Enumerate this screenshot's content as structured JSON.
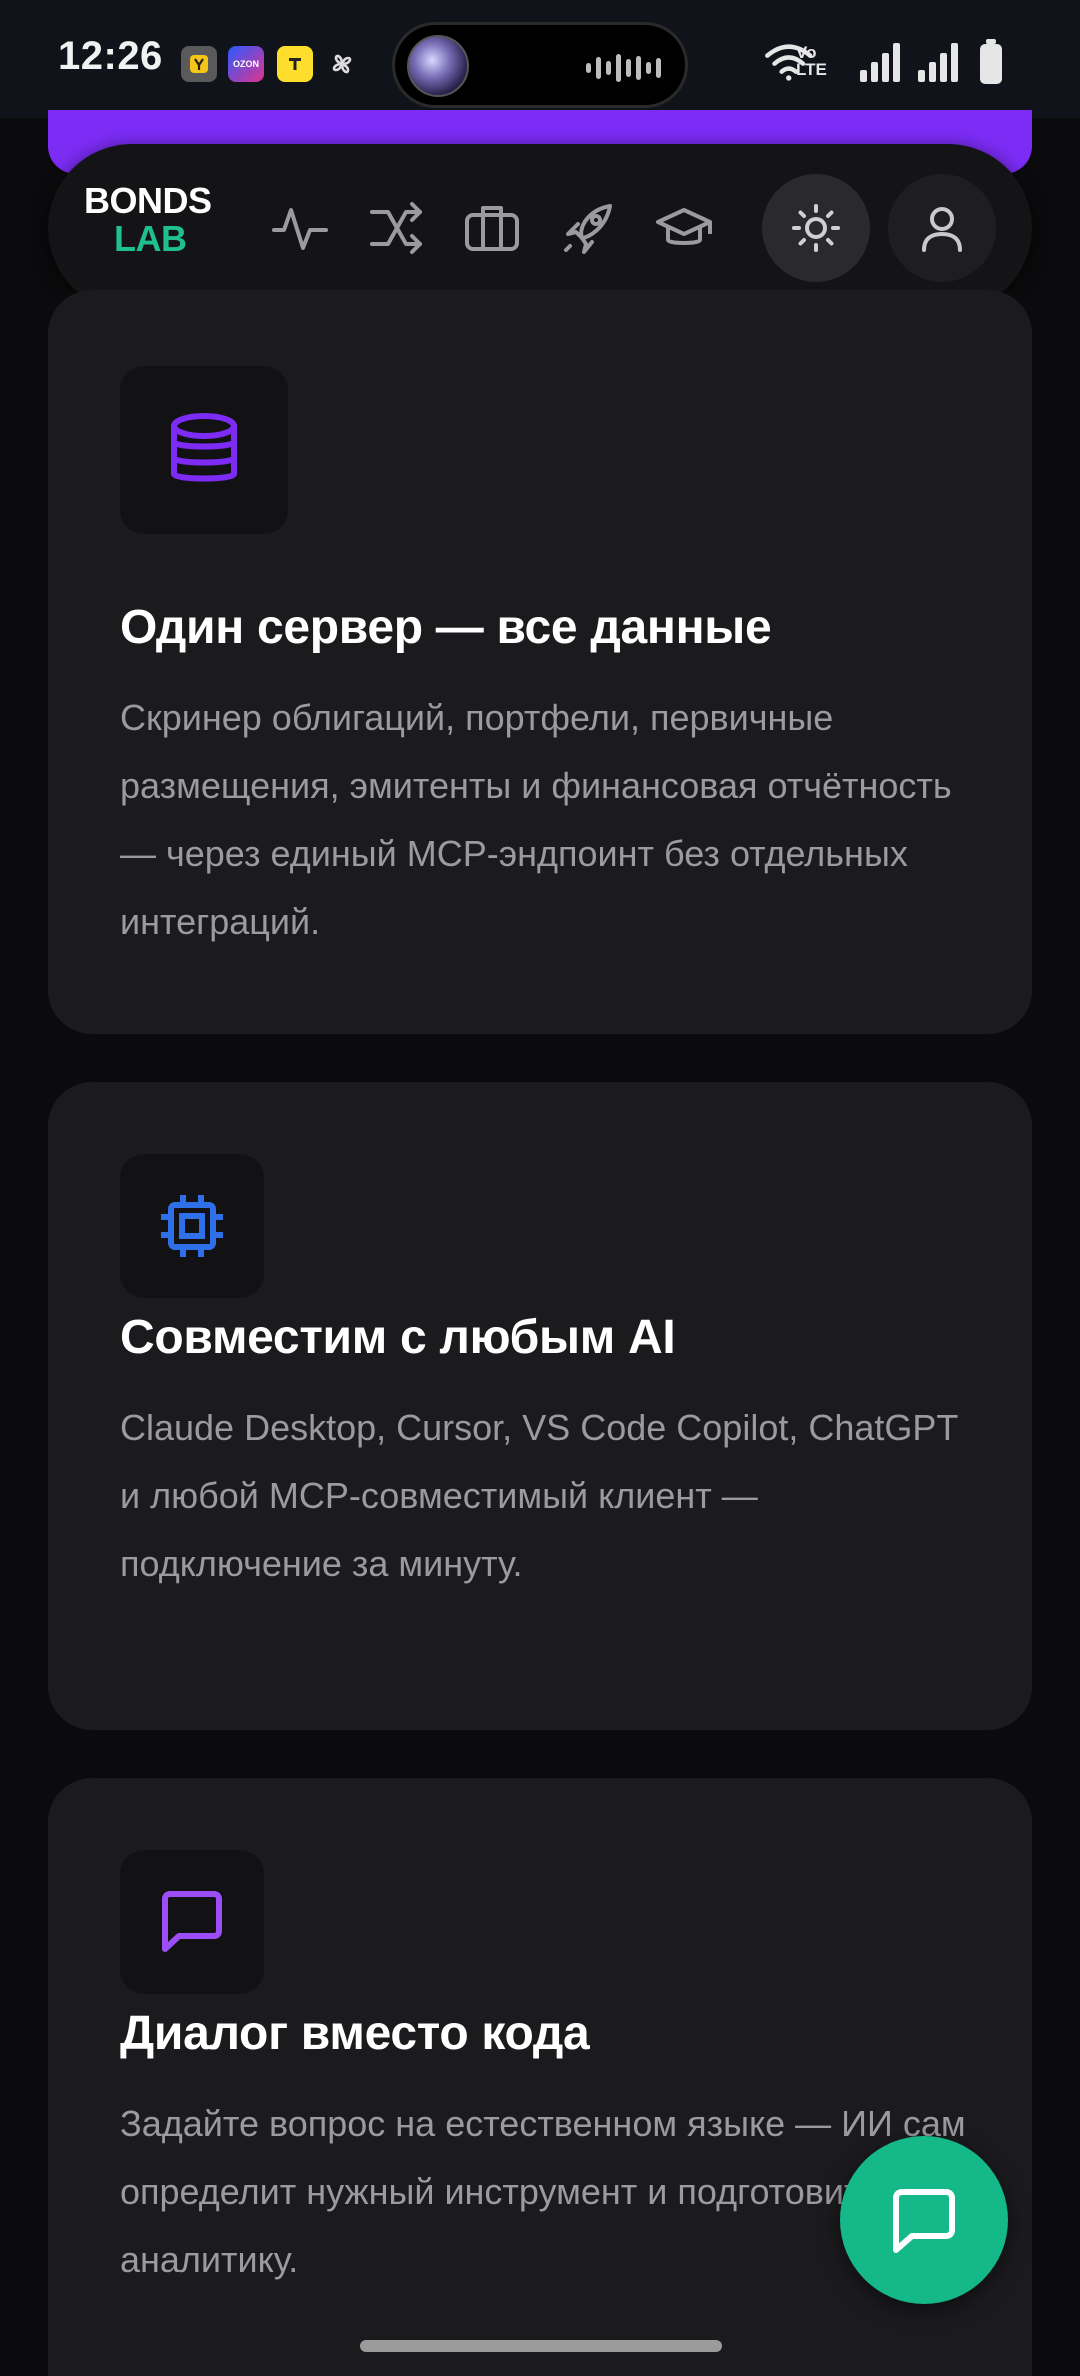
{
  "status_bar": {
    "time": "12:26",
    "notification_icons": [
      "yandex-pay-icon",
      "ozon-icon",
      "tinkoff-icon",
      "pinwheel-icon"
    ],
    "ozon_label": "OZON",
    "network_label_top": "Vo",
    "network_label_bottom": "LTE",
    "right_icons": [
      "wifi-icon",
      "volte-icon",
      "signal-icon",
      "signal-icon",
      "battery-icon"
    ]
  },
  "nav": {
    "logo_top": "BONDS",
    "logo_bottom": "LAB",
    "items": [
      {
        "name": "activity-icon"
      },
      {
        "name": "shuffle-icon"
      },
      {
        "name": "briefcase-icon"
      },
      {
        "name": "rocket-icon"
      },
      {
        "name": "graduation-cap-icon"
      }
    ],
    "theme_toggle": "sun-icon",
    "profile": "user-icon"
  },
  "colors": {
    "accent_purple": "#7c2cf5",
    "accent_green": "#1fbf8f",
    "accent_blue": "#2f6fe8",
    "card_bg": "#1b1b1e",
    "page_bg": "#0b0b0d",
    "fab_green": "#14b889"
  },
  "cards": [
    {
      "icon": "database-icon",
      "title": "Один сервер — все данные",
      "description": "Скринер облигаций, портфели, первичные размещения, эмитенты и финансовая отчётность — через единый MCP-эндпоинт без отдельных интеграций."
    },
    {
      "icon": "cpu-icon",
      "title": "Совместим с любым AI",
      "description": "Claude Desktop, Cursor, VS Code Copilot, ChatGPT и любой MCP-совместимый клиент — подключение за минуту."
    },
    {
      "icon": "chat-icon",
      "title": "Диалог вместо кода",
      "description": "Задайте вопрос на естественном языке — ИИ сам определит нужный инструмент и подготовит аналитику."
    }
  ],
  "fab": {
    "icon": "chat-bubble-icon"
  }
}
